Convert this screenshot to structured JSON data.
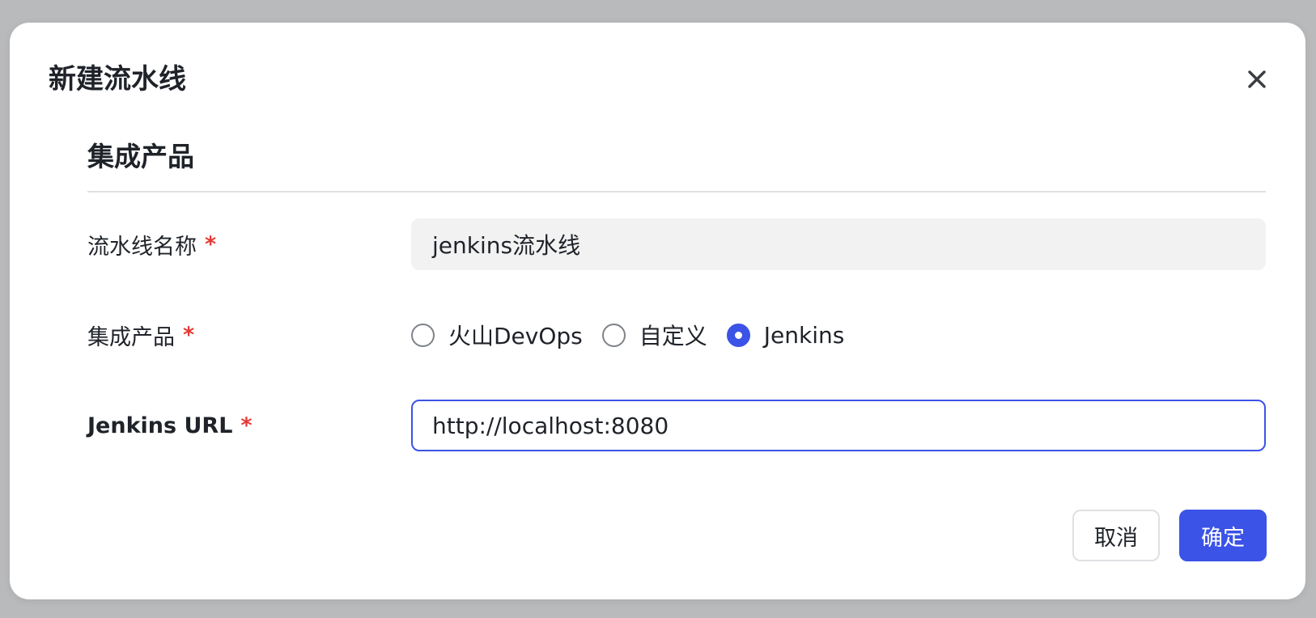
{
  "modal": {
    "title": "新建流水线",
    "close_icon": "close-icon"
  },
  "section": {
    "title": "集成产品"
  },
  "form": {
    "pipeline_name": {
      "label": "流水线名称",
      "required_mark": "*",
      "value": "jenkins流水线"
    },
    "integration_product": {
      "label": "集成产品",
      "required_mark": "*",
      "options": [
        {
          "label": "火山DevOps",
          "checked": false
        },
        {
          "label": "自定义",
          "checked": false
        },
        {
          "label": "Jenkins",
          "checked": true
        }
      ]
    },
    "jenkins_url": {
      "label": "Jenkins URL",
      "required_mark": "*",
      "value": "http://localhost:8080"
    }
  },
  "footer": {
    "cancel_label": "取消",
    "confirm_label": "确定"
  },
  "colors": {
    "accent": "#3b53e6",
    "required": "#e53935",
    "overlay": "#b9babc"
  }
}
